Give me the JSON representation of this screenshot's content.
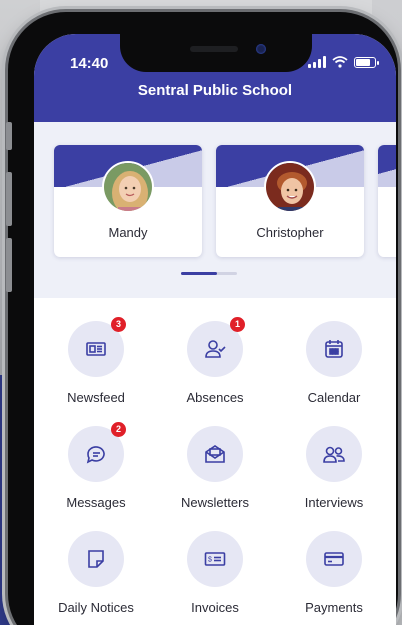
{
  "status_bar": {
    "time": "14:40"
  },
  "header": {
    "title": "Sentral Public School"
  },
  "students": [
    {
      "name": "Mandy",
      "avatar_icon": "girl-avatar"
    },
    {
      "name": "Christopher",
      "avatar_icon": "boy-avatar"
    }
  ],
  "menu": [
    {
      "label": "Newsfeed",
      "icon": "newspaper-icon",
      "badge": "3"
    },
    {
      "label": "Absences",
      "icon": "user-check-icon",
      "badge": "1"
    },
    {
      "label": "Calendar",
      "icon": "calendar-icon",
      "badge": null
    },
    {
      "label": "Messages",
      "icon": "chat-icon",
      "badge": "2"
    },
    {
      "label": "Newsletters",
      "icon": "envelope-icon",
      "badge": null
    },
    {
      "label": "Interviews",
      "icon": "users-icon",
      "badge": null
    },
    {
      "label": "Daily Notices",
      "icon": "note-icon",
      "badge": null
    },
    {
      "label": "Invoices",
      "icon": "invoice-icon",
      "badge": null
    },
    {
      "label": "Payments",
      "icon": "credit-card-icon",
      "badge": null
    }
  ],
  "colors": {
    "brand": "#3b3fa3",
    "badge": "#e02029",
    "icon_bg": "#e6e7f4"
  }
}
